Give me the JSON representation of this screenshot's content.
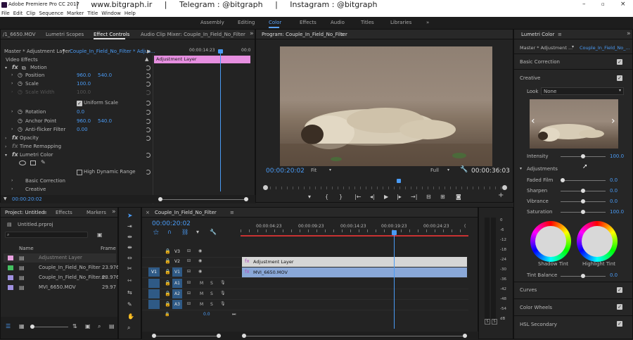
{
  "app": {
    "title": "Adobe Premiere Pro CC 2017",
    "watermark": "|     www.bitgraph.ir     |     Telegram : @bitgraph     |     Instagram : @bitgraph"
  },
  "menu": [
    "File",
    "Edit",
    "Clip",
    "Sequence",
    "Marker",
    "Title",
    "Window",
    "Help"
  ],
  "workspaces": [
    "Assembly",
    "Editing",
    "Color",
    "Effects",
    "Audio",
    "Titles",
    "Libraries"
  ],
  "source_tabs": [
    "/1_6650.MOV",
    "Lumetri Scopes",
    "Effect Controls",
    "Audio Clip Mixer: Couple_In_Field_No_Filter"
  ],
  "effect_controls": {
    "master": "Master * Adjustment Layer",
    "clip": "Couple_In_Field_No_Filter * Adjus...",
    "timecode": "00:00:14:23",
    "clip_label": "Adjustment Layer",
    "section": "Video Effects",
    "motion": "Motion",
    "position_label": "Position",
    "position_x": "960.0",
    "position_y": "540.0",
    "scale_label": "Scale",
    "scale_value": "100.0",
    "scale_width_label": "Scale Width",
    "scale_width_value": "100.0",
    "uniform_scale": "Uniform Scale",
    "rotation_label": "Rotation",
    "rotation_value": "0.0",
    "anchor_label": "Anchor Point",
    "anchor_x": "960.0",
    "anchor_y": "540.0",
    "antiflicker_label": "Anti-flicker Filter",
    "antiflicker_value": "0.00",
    "opacity": "Opacity",
    "time_remap": "Time Remapping",
    "lumetri": "Lumetri Color",
    "hdr": "High Dynamic Range",
    "basic": "Basic Correction",
    "creative": "Creative",
    "bottom_time": "00:00:20:02"
  },
  "program": {
    "title": "Program: Couple_In_Field_No_Filter",
    "timecode": "00:00:20:02",
    "fit": "Fit",
    "quality": "Full",
    "duration": "00:00:36:03"
  },
  "lumetri": {
    "title": "Lumetri Color",
    "master": "Master * Adjustment ...",
    "clip": "Couple_In_Field_No_...",
    "basic": "Basic Correction",
    "creative": "Creative",
    "look_label": "Look",
    "look_value": "None",
    "intensity_label": "Intensity",
    "intensity_value": "100.0",
    "adjustments": "Adjustments",
    "faded_label": "Faded Film",
    "faded_value": "0.0",
    "sharpen_label": "Sharpen",
    "sharpen_value": "0.0",
    "vibrance_label": "Vibrance",
    "vibrance_value": "0.0",
    "saturation_label": "Saturation",
    "saturation_value": "100.0",
    "shadow_tint": "Shadow Tint",
    "highlight_tint": "Highlight Tint",
    "tint_balance_label": "Tint Balance",
    "tint_balance_value": "0.0",
    "curves": "Curves",
    "color_wheels": "Color Wheels",
    "hsl": "HSL Secondary"
  },
  "project": {
    "tabs": [
      "Project: Untitled",
      "Effects",
      "Markers"
    ],
    "file": "Untitled.prproj",
    "col_name": "Name",
    "col_frame": "Frame",
    "items": [
      {
        "name": "Adjustment Layer",
        "fps": "",
        "color": "#e8a0e0"
      },
      {
        "name": "Couple_In_Field_No_Filter",
        "fps": "23.976",
        "color": "#44c060"
      },
      {
        "name": "Couple_In_Field_No_Filter.m",
        "fps": "23.976",
        "color": "#a090e0"
      },
      {
        "name": "MVI_6650.MOV",
        "fps": "29.97",
        "color": "#a090e0"
      }
    ]
  },
  "timeline": {
    "title": "Couple_In_Field_No_Filter",
    "timecode": "00:00:20:02",
    "ruler": [
      "00:00:04:23",
      "00:00:09:23",
      "00:00:14:23",
      "00:00:19:23",
      "00:00:24:23"
    ],
    "tracks": [
      "V3",
      "V2",
      "V1",
      "A1",
      "A2",
      "A3"
    ],
    "src": "V1",
    "clip_adjust": "Adjustment Layer",
    "clip_video": "MVI_6650.MOV",
    "master_val": "0.0",
    "meter_ticks": [
      "0",
      "-6",
      "-12",
      "-18",
      "-24",
      "-30",
      "-36",
      "-42",
      "-48",
      "-54",
      "dB"
    ],
    "solo": [
      "S",
      "S"
    ]
  }
}
